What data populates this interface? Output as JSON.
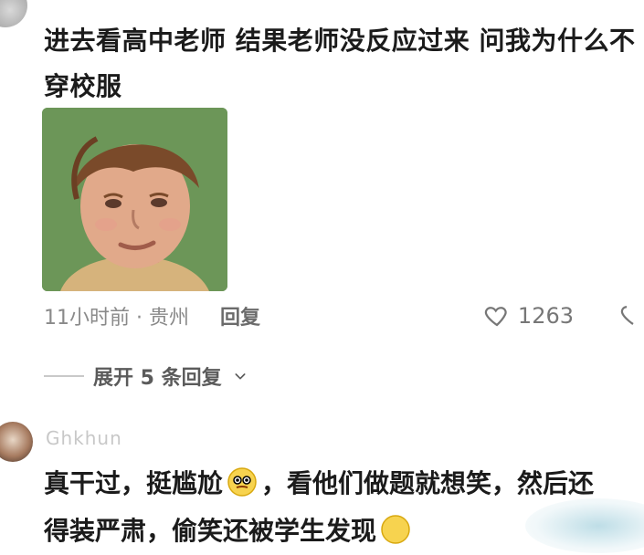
{
  "comment1": {
    "text": "进去看高中老师 结果老师没反应过来 问我为什么不穿校服",
    "meta_time": "11小时前 · 贵州",
    "reply_label": "回复",
    "like_count": "1263"
  },
  "thread": {
    "expand_label": "展开 5 条回复"
  },
  "comment2": {
    "username": "Ghkhun",
    "text_part1": "真干过，挺尴尬",
    "text_part2": "，看他们做题就想笑，然后还",
    "text_part3": "得装严肃，偷笑还被学生发现"
  },
  "icons": {
    "heart": "heart-outline-icon",
    "chevron": "chevron-down-icon",
    "emoji1": "flushed-emoji-icon",
    "emoji2": "smile-emoji-icon"
  },
  "colors": {
    "text": "#1b1b1b",
    "meta": "#8a8a8a",
    "reply": "#6b6b6b",
    "like": "#777777"
  }
}
